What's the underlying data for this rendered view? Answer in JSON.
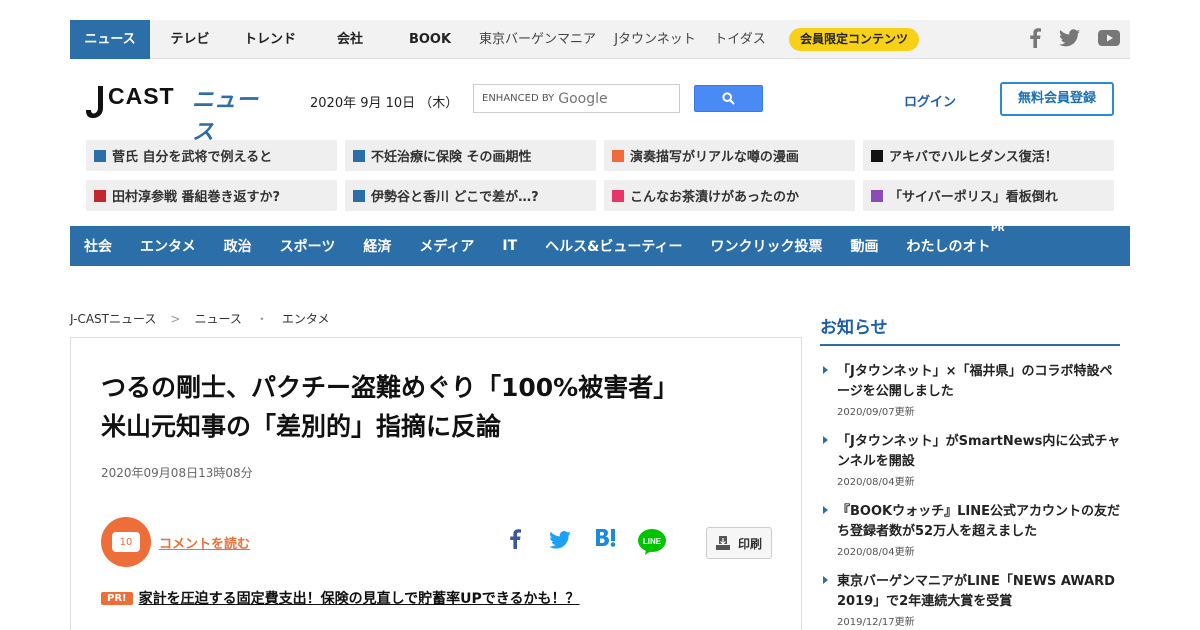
{
  "topnav": {
    "items": [
      {
        "label": "ニュース",
        "width": 80
      },
      {
        "label": "テレビ",
        "width": 80
      },
      {
        "label": "トレンド",
        "width": 80
      },
      {
        "label": "会社",
        "width": 80
      },
      {
        "label": "BOOK",
        "width": 80
      }
    ],
    "sub_items": [
      "東京バーゲンマニア",
      "Jタウンネット",
      "トイダス"
    ],
    "member_label": "会員限定コンテンツ"
  },
  "header": {
    "logo_j": "J",
    "logo_cast": "CAST",
    "logo_news": "ニュース",
    "date": "2020年 9月 10日 （木）",
    "search_prefix": "ENHANCED BY",
    "search_brand": "Google",
    "login": "ログイン",
    "register": "無料会員登録"
  },
  "trending": [
    {
      "text": "菅氏 自分を武将で例えると",
      "color": "#2b6ea8"
    },
    {
      "text": "不妊治療に保険 その画期性",
      "color": "#2b6ea8"
    },
    {
      "text": "演奏描写がリアルな噂の漫画",
      "color": "#f26b3a"
    },
    {
      "text": "アキバでハルヒダンス復活！",
      "color": "#111111"
    },
    {
      "text": "田村淳参戦 番組巻き返すか?",
      "color": "#c0282d"
    },
    {
      "text": "伊勢谷と香川 どこで差が…?",
      "color": "#2b6ea8"
    },
    {
      "text": "こんなお茶漬けがあったのか",
      "color": "#e8336b"
    },
    {
      "text": "「サイバーポリス」看板倒れ",
      "color": "#8a4cb5"
    }
  ],
  "categories": [
    "社会",
    "エンタメ",
    "政治",
    "スポーツ",
    "経済",
    "メディア",
    "IT",
    "ヘルス&ビューティー",
    "ワンクリック投票",
    "動画",
    "わたしのオト"
  ],
  "category_pr": "PR",
  "breadcrumb": [
    "J-CASTニュース",
    "ニュース",
    "エンタメ"
  ],
  "breadcrumb_seps": [
    ">",
    "・"
  ],
  "article": {
    "title": "つるの剛士、パクチー盗難めぐり「100%被害者」　米山元知事の「差別的」指摘に反論",
    "published": "2020年09月08日13時08分",
    "comment_count": "10",
    "comment_link": "コメントを読む",
    "print": "印刷",
    "pr_badge": "PR!",
    "pr_text": "家計を圧迫する固定費支出！保険の見直しで貯蓄率UPできるかも！？"
  },
  "sidebar": {
    "title": "お知らせ",
    "news": [
      {
        "title": "「Jタウンネット」×「福井県」のコラボ特設ページを公開しました",
        "date": "2020/09/07更新"
      },
      {
        "title": "「Jタウンネット」がSmartNews内に公式チャンネルを開設",
        "date": "2020/08/04更新"
      },
      {
        "title": "『BOOKウォッチ』LINE公式アカウントの友だち登録者数が52万人を超えました",
        "date": "2020/08/04更新"
      },
      {
        "title": "東京バーゲンマニアがLINE「NEWS AWARD 2019」で2年連続大賞を受賞",
        "date": "2019/12/17更新"
      }
    ]
  },
  "share_icons": [
    "facebook-icon",
    "twitter-icon",
    "hatena-bookmark-icon",
    "line-icon"
  ],
  "colors": {
    "brand": "#2b6ea8",
    "accent": "#ee6e3a",
    "badge": "#f7d117"
  }
}
